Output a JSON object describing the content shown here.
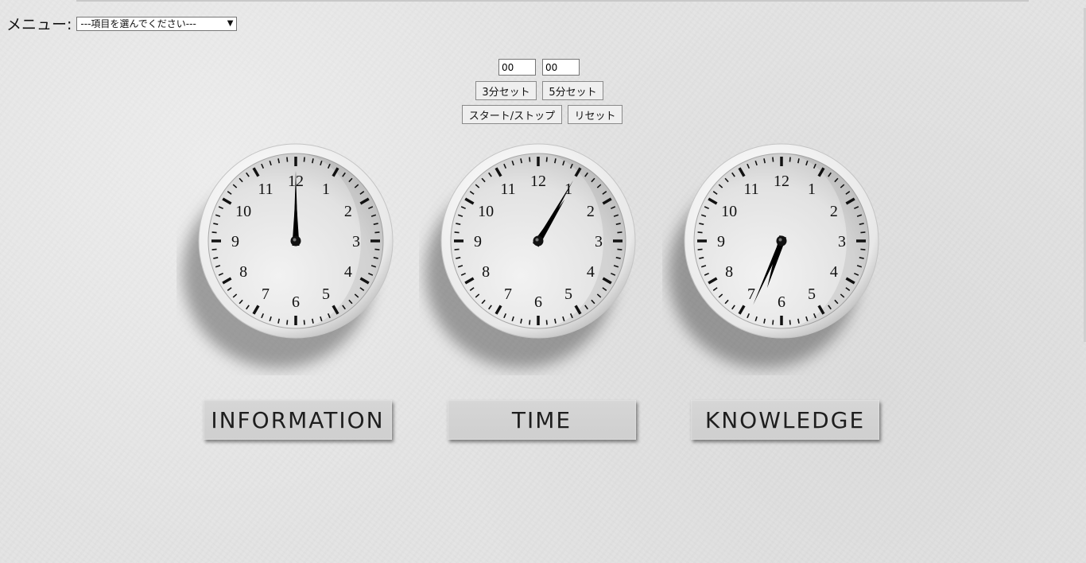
{
  "menu": {
    "label": "メニュー:",
    "select_value": "---項目を選んでください---"
  },
  "timer": {
    "minutes_value": "00",
    "seconds_value": "00",
    "btn_3min": "3分セット",
    "btn_5min": "5分セット",
    "btn_startstop": "スタート/ストップ",
    "btn_reset": "リセット"
  },
  "clocks": [
    {
      "name": "INFORMATION",
      "hour": 12,
      "minute": 0
    },
    {
      "name": "TIME",
      "hour": 1,
      "minute": 5
    },
    {
      "name": "KNOWLEDGE",
      "hour": 6,
      "minute": 34
    }
  ],
  "dial_numerals": [
    "12",
    "1",
    "2",
    "3",
    "4",
    "5",
    "6",
    "7",
    "8",
    "9",
    "10",
    "11"
  ],
  "colors": {
    "background": "#e4e4e4",
    "hands": "#000000"
  }
}
